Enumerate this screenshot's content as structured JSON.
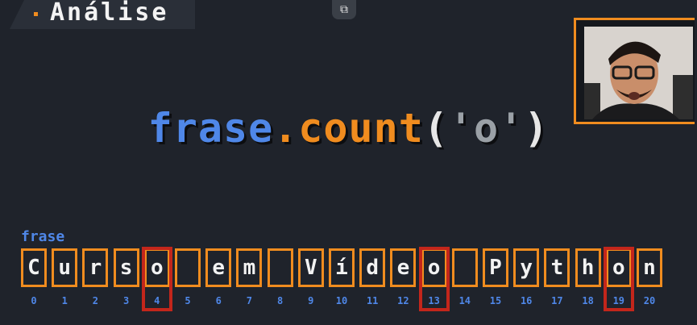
{
  "header": {
    "title": "Análise"
  },
  "code": {
    "object": "frase",
    "dot": ".",
    "method": "count",
    "open": "(",
    "arg": "'o'",
    "close": ")"
  },
  "variable": {
    "label": "frase"
  },
  "string_chars": [
    "C",
    "u",
    "r",
    "s",
    "o",
    " ",
    "e",
    "m",
    " ",
    "V",
    "í",
    "d",
    "e",
    "o",
    " ",
    "P",
    "y",
    "t",
    "h",
    "o",
    "n"
  ],
  "indices": [
    "0",
    "1",
    "2",
    "3",
    "4",
    "5",
    "6",
    "7",
    "8",
    "9",
    "10",
    "11",
    "12",
    "13",
    "14",
    "15",
    "16",
    "17",
    "18",
    "19",
    "20"
  ],
  "highlighted_indices": [
    4,
    13,
    19
  ],
  "icons": {
    "popout": "popout-icon"
  },
  "colors": {
    "background": "#1f232b",
    "accent": "#f08c1f",
    "blue": "#4f87e8",
    "highlight": "#c3261b"
  }
}
